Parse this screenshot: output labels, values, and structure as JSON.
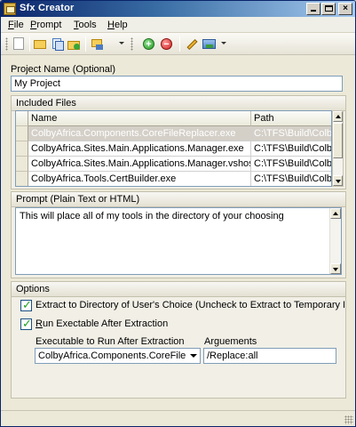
{
  "window": {
    "title": "Sfx Creator"
  },
  "menu": [
    {
      "label": "File",
      "accel": "F",
      "rest": "ile"
    },
    {
      "label": "Prompt",
      "accel": "P",
      "rest": "rompt"
    },
    {
      "label": "Tools",
      "accel": "T",
      "rest": "ools"
    },
    {
      "label": "Help",
      "accel": "H",
      "rest": "elp"
    }
  ],
  "toolbar": {
    "icons": [
      "new-icon",
      "open-icon",
      "copy-icon",
      "add-folder-icon",
      "import-icon",
      "add-icon",
      "remove-icon",
      "edit-icon",
      "image-icon"
    ]
  },
  "project": {
    "label": "Project Name (Optional)",
    "value": "My Project"
  },
  "included_files": {
    "title": "Included Files",
    "columns": [
      "Name",
      "Path"
    ],
    "rows": [
      {
        "name": "ColbyAfrica.Components.CoreFileReplacer.exe",
        "path": "C:\\TFS\\Build\\ColbyAfri...",
        "selected": true
      },
      {
        "name": "ColbyAfrica.Sites.Main.Applications.Manager.exe",
        "path": "C:\\TFS\\Build\\ColbyAfri...",
        "selected": false
      },
      {
        "name": "ColbyAfrica.Sites.Main.Applications.Manager.vshost.exe",
        "path": "C:\\TFS\\Build\\ColbyAfri...",
        "selected": false
      },
      {
        "name": "ColbyAfrica.Tools.CertBuilder.exe",
        "path": "C:\\TFS\\Build\\ColbyAfri...",
        "selected": false
      }
    ]
  },
  "prompt": {
    "title": "Prompt (Plain Text or HTML)",
    "value": "This will place all of my tools in the directory of your choosing"
  },
  "options": {
    "title": "Options",
    "extract_to_choice": {
      "label": "Extract to Directory of User's Choice (Uncheck to Extract to Temporary Location)",
      "checked": true
    },
    "run_after": {
      "label_accel": "R",
      "label_rest": "un Exectable After Extraction",
      "checked": true
    },
    "executable_label": "Executable to Run After Extraction",
    "executable_value": "ColbyAfrica.Components.CoreFileReplacer",
    "arguments_label": "Arguements",
    "arguments_value": "/Replace:all"
  }
}
